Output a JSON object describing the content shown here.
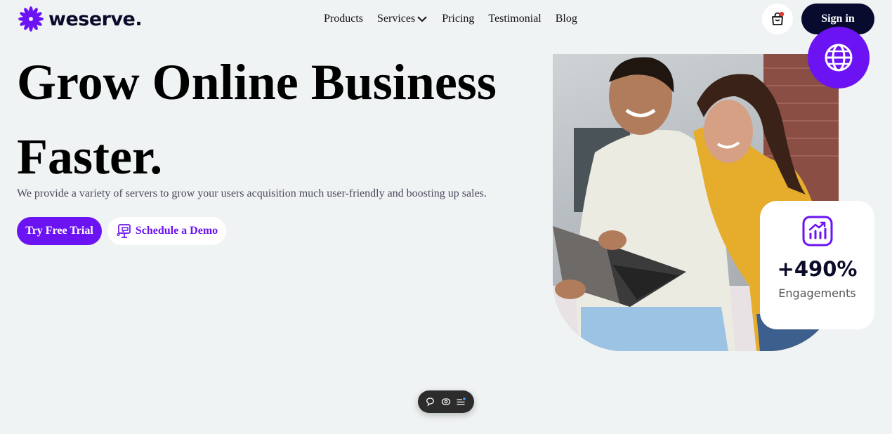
{
  "brand": {
    "name": "weserve."
  },
  "nav": {
    "items": [
      "Products",
      "Services",
      "Pricing",
      "Testimonial",
      "Blog"
    ]
  },
  "header": {
    "sign_in_label": "Sign in"
  },
  "hero": {
    "title_line1": "Grow Online Business",
    "title_line2": "Faster.",
    "subtitle": "We provide a variety of servers to grow your users acquisition much user-friendly and boosting up sales.",
    "primary_cta": "Try Free Trial",
    "secondary_cta": "Schedule a Demo"
  },
  "stat": {
    "value": "+490%",
    "label": "Engagements"
  },
  "colors": {
    "accent": "#6c13f3",
    "dark": "#080a2e",
    "background": "#f0f3f4",
    "notification_dot": "#e53935"
  },
  "icons": {
    "logo": "purple-flower-icon",
    "cart": "shopping-bag-icon",
    "globe": "globe-icon",
    "chart": "growth-chart-icon",
    "demo": "monitor-chat-icon",
    "toolbar": [
      "comment-icon",
      "view-icon",
      "menu-icon"
    ]
  }
}
